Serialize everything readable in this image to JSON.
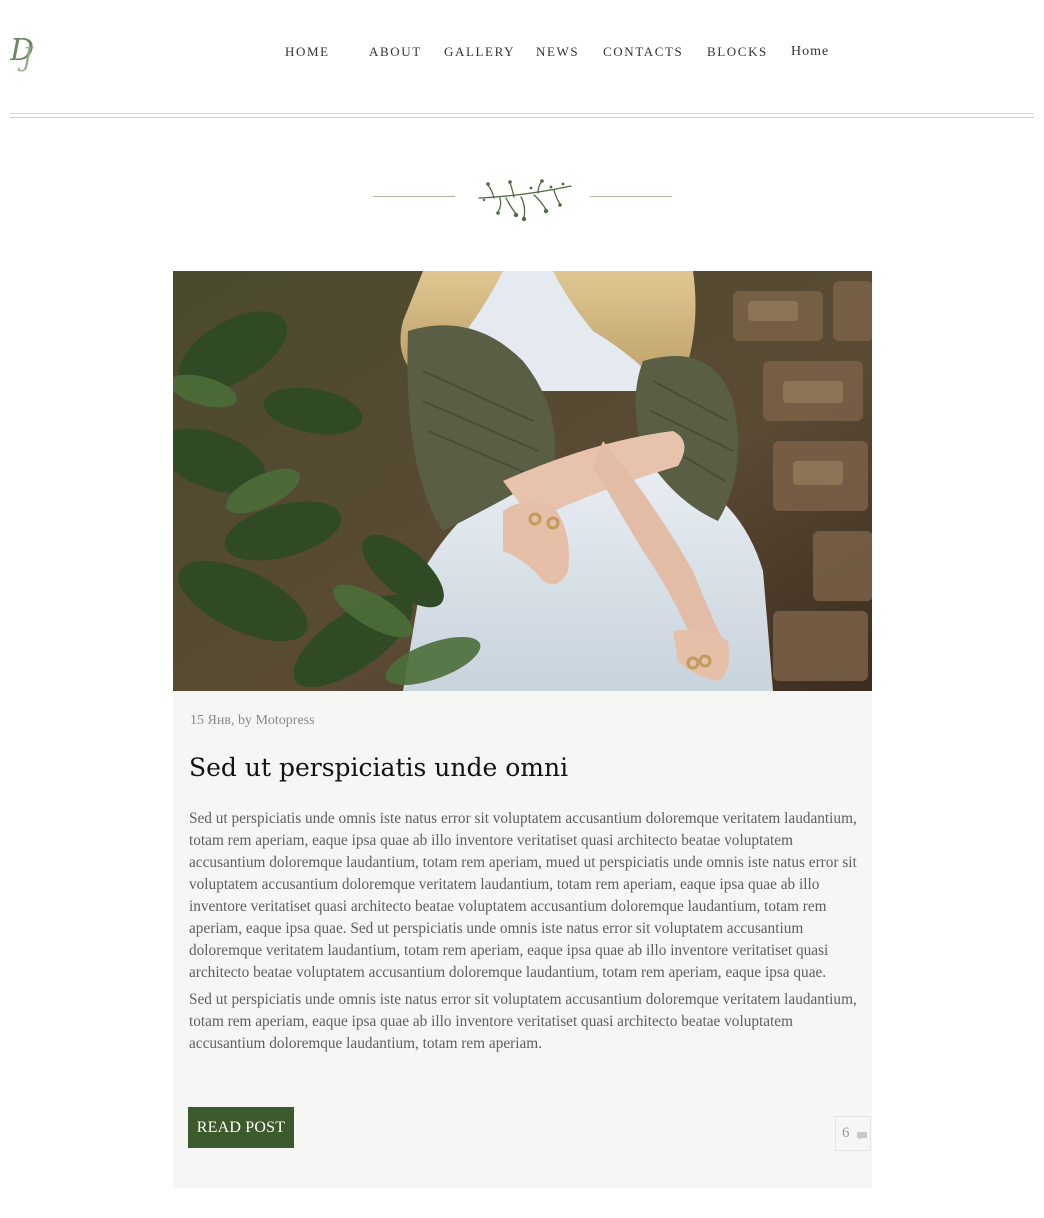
{
  "brand": {
    "logo_text": "DJ",
    "colors": {
      "primary": "#3d5a2c",
      "logo": "#6a8a5e",
      "rule": "#d9d3c6"
    }
  },
  "nav": {
    "items": [
      {
        "label": "HOME"
      },
      {
        "label": "ABOUT"
      },
      {
        "label": "GALLERY"
      },
      {
        "label": "NEWS"
      },
      {
        "label": "CONTACTS"
      },
      {
        "label": "BLOCKS"
      },
      {
        "label": "Home"
      }
    ]
  },
  "divider": {
    "icon": "leaf-sprig-icon"
  },
  "post": {
    "image": "post-photo",
    "meta": "15 Янв, by Motopress",
    "title": "Sed ut perspiciatis unde omni",
    "paragraphs": [
      "Sed ut perspiciatis unde omnis iste natus error sit voluptatem accusantium doloremque veritatem laudantium, totam rem aperiam, eaque ipsa quae ab illo inventore veritatiset quasi architecto beatae voluptatem accusantium doloremque laudantium, totam rem aperiam, mued ut perspiciatis unde omnis iste natus error sit voluptatem accusantium doloremque veritatem laudantium, totam rem aperiam, eaque ipsa quae ab illo inventore veritatiset quasi architecto beatae voluptatem accusantium doloremque laudantium, totam rem aperiam, eaque ipsa quae. Sed ut perspiciatis unde omnis iste natus error sit voluptatem accusantium doloremque veritatem laudantium, totam rem aperiam, eaque ipsa quae ab illo inventore veritatiset quasi architecto beatae voluptatem accusantium doloremque laudantium, totam rem aperiam, eaque ipsa quae.",
      "Sed ut perspiciatis unde omnis iste natus error sit voluptatem accusantium doloremque veritatem laudantium, totam rem aperiam, eaque ipsa quae ab illo inventore veritatiset quasi architecto beatae voluptatem accusantium doloremque laudantium, totam rem aperiam."
    ],
    "read_label": "READ POST",
    "comment_count": "6",
    "comment_icon": "comment-bubble-icon"
  }
}
